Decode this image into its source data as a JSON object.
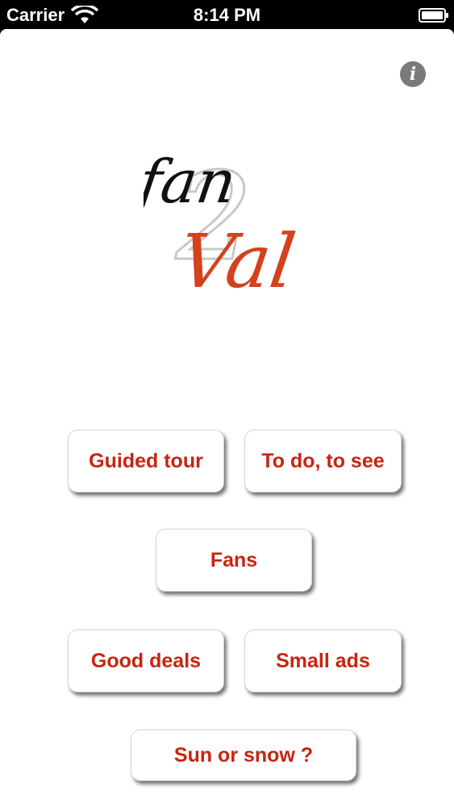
{
  "status_bar": {
    "carrier": "Carrier",
    "time": "8:14 PM",
    "wifi_icon": "wifi-icon",
    "battery_icon": "battery-icon"
  },
  "info_icon": "info-icon",
  "logo": {
    "word1": "fan",
    "word2": "Val",
    "numeral": "2",
    "colors": {
      "fan": "#111111",
      "val": "#d4411d",
      "numeral": "#cfcfcf"
    }
  },
  "buttons": {
    "guided_tour": "Guided tour",
    "to_do_to_see": "To do, to see",
    "fans": "Fans",
    "good_deals": "Good deals",
    "small_ads": "Small ads",
    "sun_or_snow": "Sun or snow ?"
  },
  "colors": {
    "button_text": "#c62510",
    "background": "#ffffff",
    "status_bar": "#000000"
  }
}
